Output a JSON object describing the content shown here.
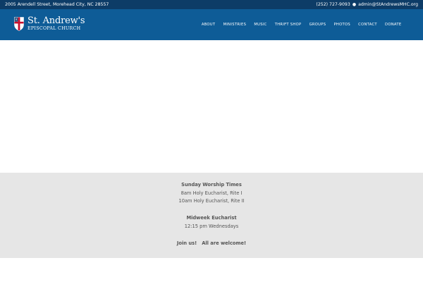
{
  "topbar": {
    "address": "2005 Arendell Street, Morehead City, NC 28557",
    "phone": "(252) 727-9093",
    "separator": "●",
    "email": "admin@StAndrewsMHC.org"
  },
  "logo": {
    "title": "St. Andrew's",
    "subtitle": "EPISCOPAL CHURCH",
    "shield_icon": "episcopal-shield-icon"
  },
  "nav": {
    "items": [
      "ABOUT",
      "MINISTRIES",
      "MUSIC",
      "THRIFT SHOP",
      "GROUPS",
      "PHOTOS",
      "CONTACT",
      "DONATE"
    ]
  },
  "worship": {
    "sunday_heading": "Sunday Worship Times",
    "sunday_1": "8am Holy Eucharist, Rite I",
    "sunday_2": "10am Holy Eucharist, Rite II",
    "midweek_heading": "Midweek Eucharist",
    "midweek_1": "12:15 pm Wednesdays",
    "join_1": "Join us!",
    "join_2": "All are welcome!"
  },
  "colors": {
    "topbar_bg": "#0d3c67",
    "header_bg": "#0e5c97",
    "info_bg": "#e6e6e6",
    "shield_red": "#c8102e"
  }
}
